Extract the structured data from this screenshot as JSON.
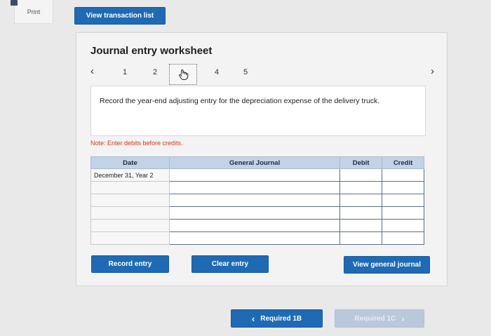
{
  "toolbar": {
    "print_label": "Print",
    "view_transaction_list": "View transaction list"
  },
  "worksheet": {
    "title": "Journal entry worksheet",
    "pages": [
      "1",
      "2",
      "3",
      "4",
      "5"
    ],
    "current_page": "3",
    "prompt": "Record the year-end adjusting entry for the depreciation expense of the delivery truck.",
    "note": "Note: Enter debits before credits."
  },
  "table": {
    "headers": {
      "date": "Date",
      "general_journal": "General Journal",
      "debit": "Debit",
      "credit": "Credit"
    },
    "rows": [
      {
        "date": "December 31, Year 2",
        "account": "",
        "debit": "",
        "credit": ""
      },
      {
        "date": "",
        "account": "",
        "debit": "",
        "credit": ""
      },
      {
        "date": "",
        "account": "",
        "debit": "",
        "credit": ""
      },
      {
        "date": "",
        "account": "",
        "debit": "",
        "credit": ""
      },
      {
        "date": "",
        "account": "",
        "debit": "",
        "credit": ""
      },
      {
        "date": "",
        "account": "",
        "debit": "",
        "credit": ""
      }
    ]
  },
  "actions": {
    "record_entry": "Record entry",
    "clear_entry": "Clear entry",
    "view_general_journal": "View general journal"
  },
  "navigation": {
    "prev_label": "Required 1B",
    "next_label": "Required 1C"
  },
  "icons": {
    "prev": "chevron-left-icon",
    "next": "chevron-right-icon",
    "current_page": "hand-pointer-icon"
  },
  "colors": {
    "primary_button": "#1f6ab4",
    "disabled_button": "#b9c8da",
    "table_header": "#c2d3e8",
    "note_text": "#d2381b"
  }
}
